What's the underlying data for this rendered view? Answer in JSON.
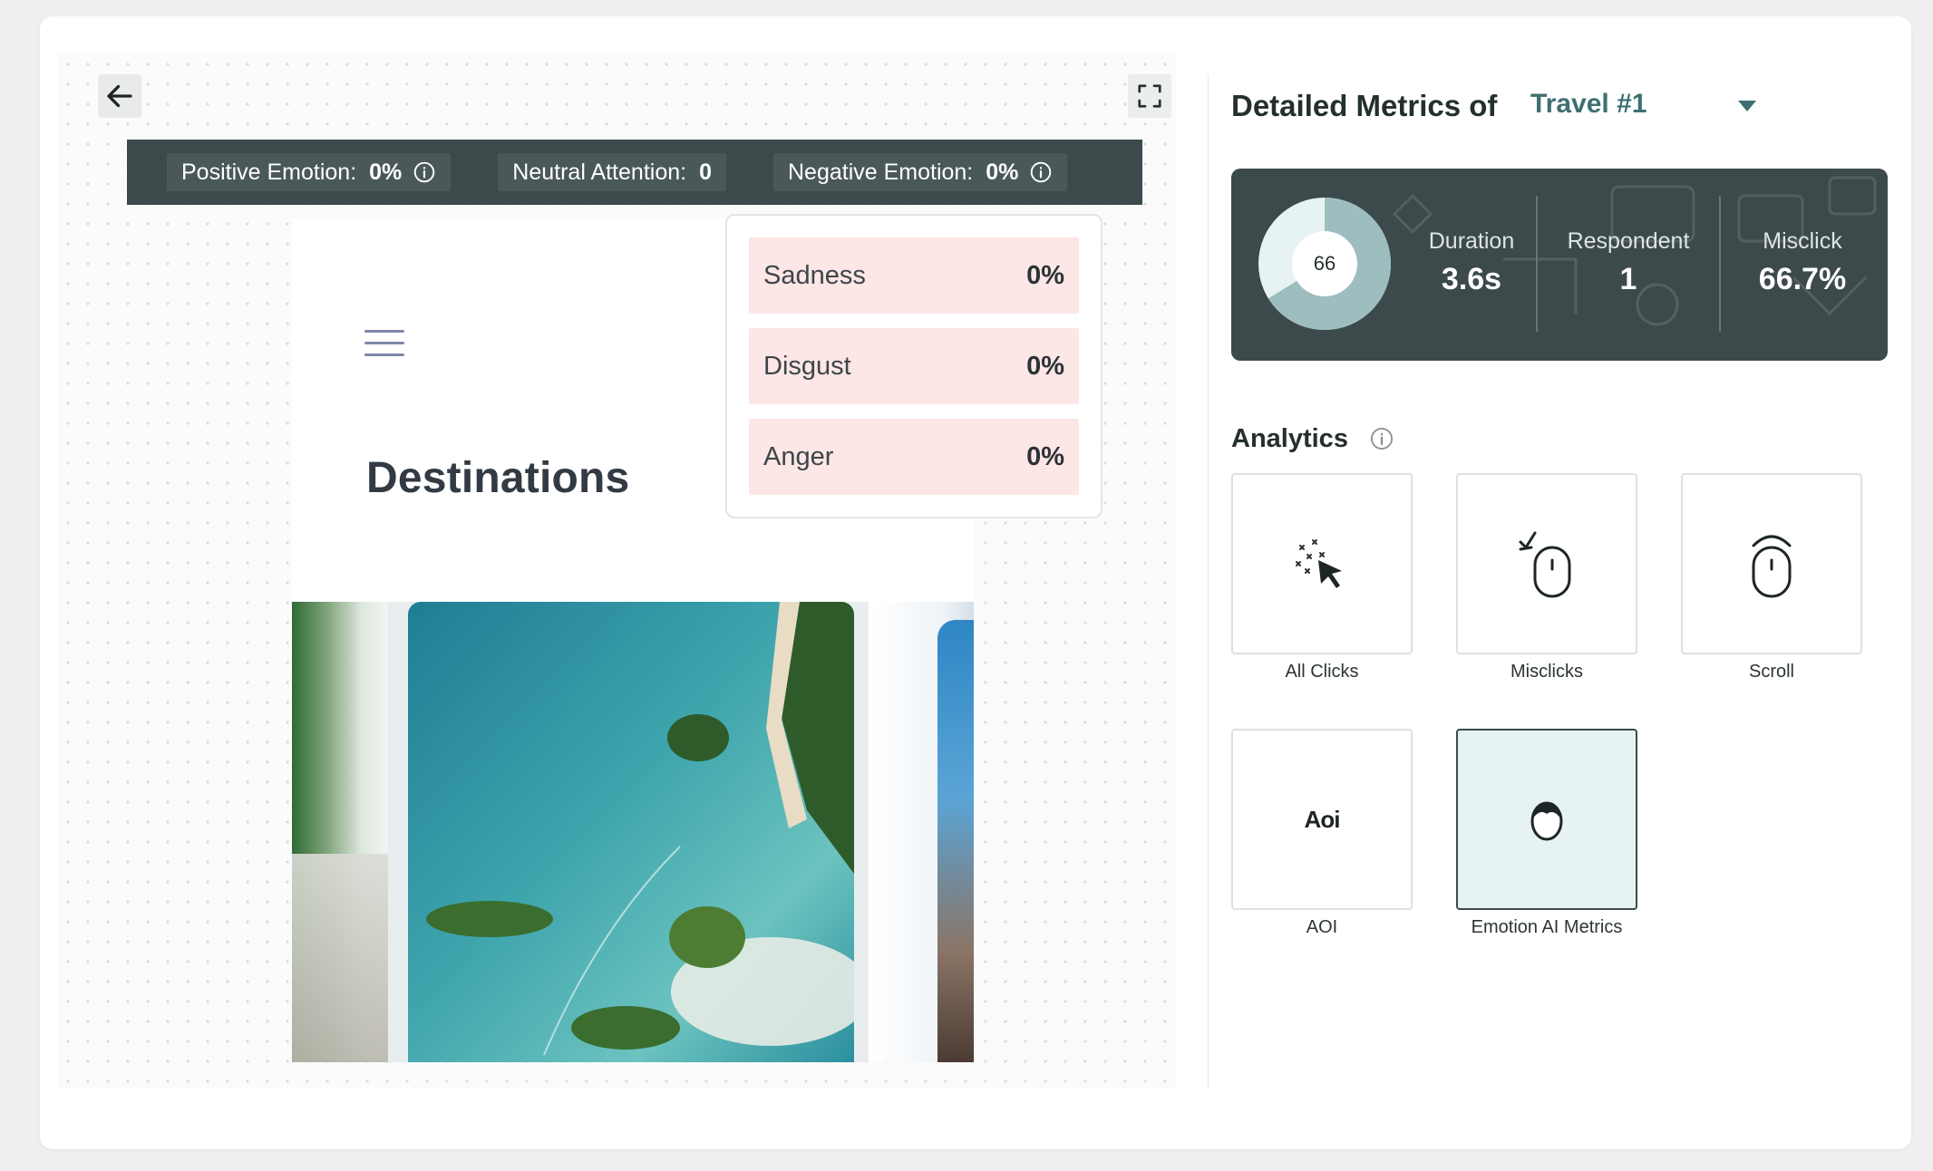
{
  "emotion_bar": {
    "positive": {
      "label": "Positive Emotion:",
      "value": "0%"
    },
    "neutral": {
      "label": "Neutral Attention:",
      "value": "0"
    },
    "negative": {
      "label": "Negative Emotion:",
      "value": "0%"
    }
  },
  "negative_breakdown": [
    {
      "label": "Sadness",
      "value": "0%"
    },
    {
      "label": "Disgust",
      "value": "0%"
    },
    {
      "label": "Anger",
      "value": "0%"
    }
  ],
  "preview": {
    "title": "Destinations"
  },
  "metrics": {
    "title": "Detailed Metrics of",
    "selected": "Travel #1",
    "donut_value": "66",
    "duration": {
      "label": "Duration",
      "value": "3.6s"
    },
    "respondent": {
      "label": "Respondent",
      "value": "1"
    },
    "misclick": {
      "label": "Misclick",
      "value": "66.7%"
    }
  },
  "analytics": {
    "title": "Analytics",
    "tiles": [
      {
        "label": "All Clicks",
        "icon": "clicks-icon"
      },
      {
        "label": "Misclicks",
        "icon": "misclick-mouse-icon"
      },
      {
        "label": "Scroll",
        "icon": "scroll-mouse-icon"
      },
      {
        "label": "AOI",
        "icon": "aoi-icon",
        "icon_text": "Aoi"
      },
      {
        "label": "Emotion AI Metrics",
        "icon": "face-icon",
        "active": true
      }
    ]
  },
  "colors": {
    "dark_panel": "#3c4a4b",
    "accent": "#3e6f72",
    "negative_row": "#fde6e6",
    "active_tile": "#e7f3f3"
  }
}
